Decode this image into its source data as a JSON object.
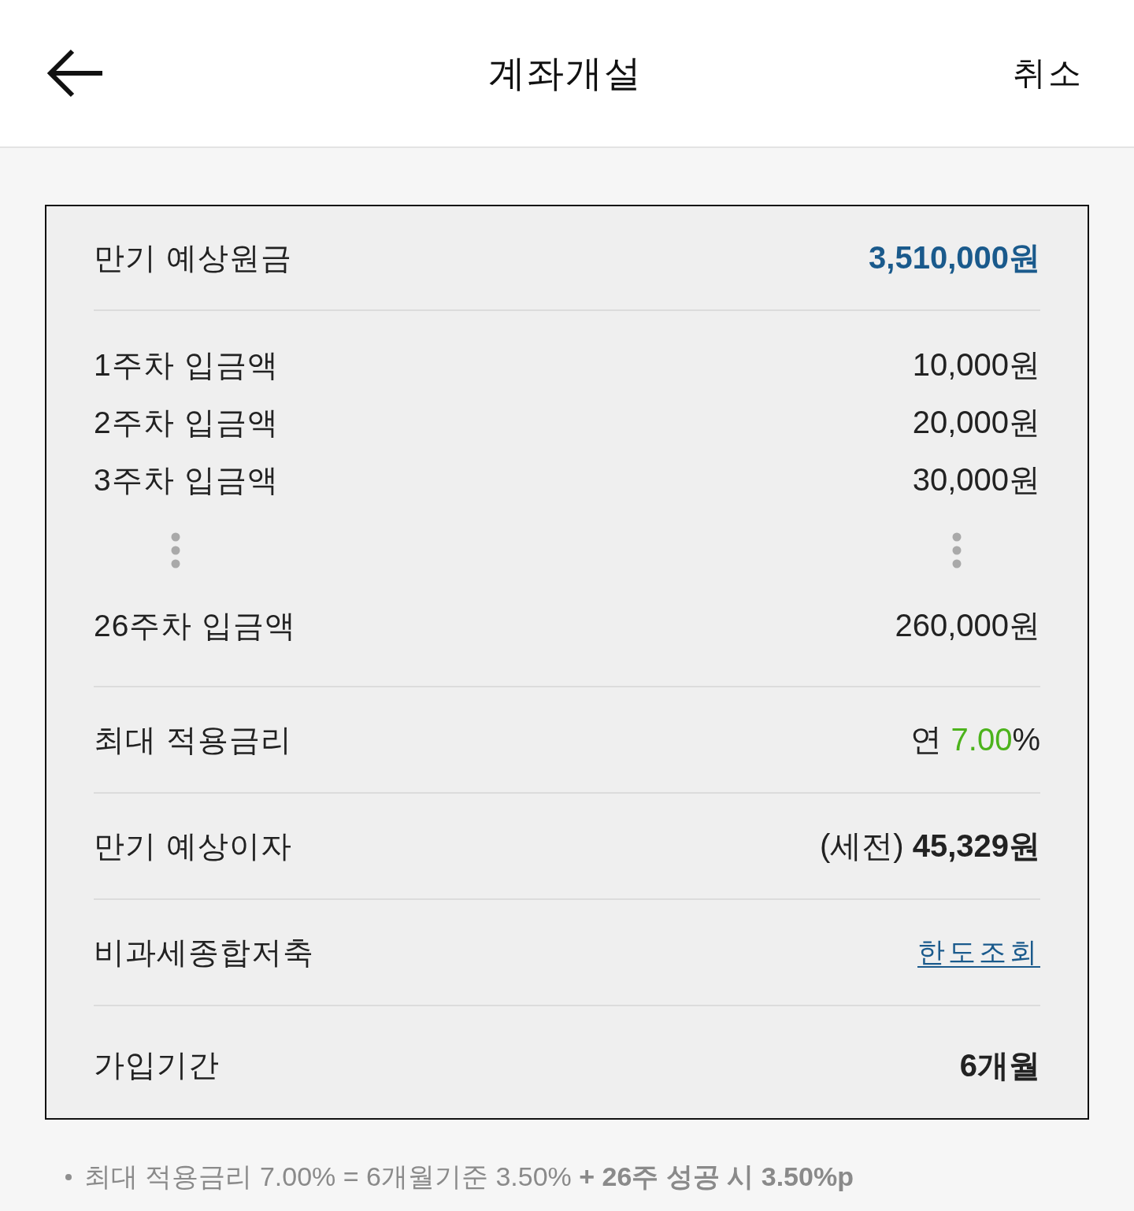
{
  "header": {
    "title": "계좌개설",
    "cancel": "취소"
  },
  "maturity_principal": {
    "label": "만기 예상원금",
    "value": "3,510,000원"
  },
  "deposits": [
    {
      "kind": "amount",
      "label": "1주차 입금액",
      "value": "10,000원"
    },
    {
      "kind": "amount",
      "label": "2주차 입금액",
      "value": "20,000원"
    },
    {
      "kind": "amount",
      "label": "3주차 입금액",
      "value": "30,000원"
    },
    {
      "kind": "ellipsis"
    },
    {
      "kind": "amount",
      "label": "26주차 입금액",
      "value": "260,000원"
    }
  ],
  "max_rate": {
    "label": "최대 적용금리",
    "prefix": "연",
    "rate": "7.00",
    "unit": "%"
  },
  "maturity_interest": {
    "label": "만기 예상이자",
    "value": "(세전) **45,329원**"
  },
  "tax_free": {
    "label": "비과세종합저축",
    "link": "한도조회"
  },
  "period": {
    "label": "가입기간",
    "value": "6개월"
  },
  "footnote": {
    "text": "최대 적용금리 7.00% = 6개월기준 3.50% **+ 26주 성공 시 3.50%p**"
  }
}
